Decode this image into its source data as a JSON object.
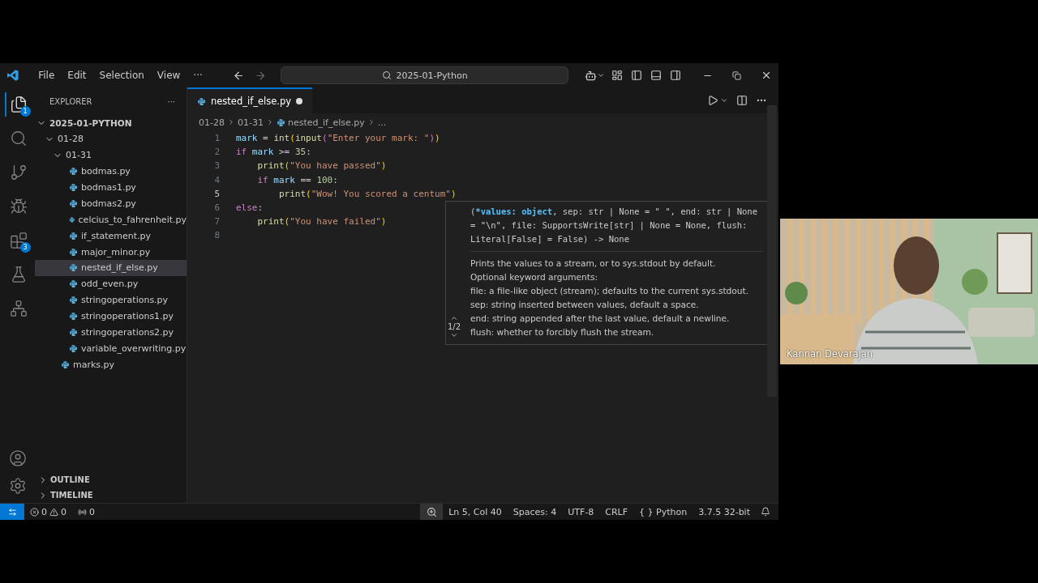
{
  "titlebar": {
    "menus": [
      "File",
      "Edit",
      "Selection",
      "View"
    ],
    "more": "···",
    "search": "2025-01-Python"
  },
  "activity_bar": [
    {
      "kind": "files",
      "badge": "1",
      "selected": true
    },
    {
      "kind": "search",
      "selected": false
    },
    {
      "kind": "git",
      "selected": false
    },
    {
      "kind": "debug",
      "selected": false
    },
    {
      "kind": "extensions",
      "badge": "3",
      "selected": false
    },
    {
      "kind": "flask",
      "selected": false
    },
    {
      "kind": "tree",
      "selected": false
    }
  ],
  "explorer": {
    "title": "EXPLORER",
    "more": "···",
    "tree": [
      {
        "label": "2025-01-PYTHON",
        "kind": "folder",
        "expanded": true,
        "children": [
          {
            "label": "01-28",
            "kind": "folder",
            "expanded": true,
            "children": [
              {
                "label": "01-31",
                "kind": "folder",
                "expanded": true,
                "children": [
                  {
                    "label": "bodmas.py",
                    "kind": "file",
                    "selected": false
                  },
                  {
                    "label": "bodmas1.py",
                    "kind": "file",
                    "selected": false
                  },
                  {
                    "label": "bodmas2.py",
                    "kind": "file",
                    "selected": false
                  },
                  {
                    "label": "celcius_to_fahrenheit.py",
                    "kind": "file",
                    "selected": false
                  },
                  {
                    "label": "if_statement.py",
                    "kind": "file",
                    "selected": false
                  },
                  {
                    "label": "major_minor.py",
                    "kind": "file",
                    "selected": false
                  },
                  {
                    "label": "nested_if_else.py",
                    "kind": "file",
                    "selected": true
                  },
                  {
                    "label": "odd_even.py",
                    "kind": "file",
                    "selected": false
                  },
                  {
                    "label": "stringoperations.py",
                    "kind": "file",
                    "selected": false
                  },
                  {
                    "label": "stringoperations1.py",
                    "kind": "file",
                    "selected": false
                  },
                  {
                    "label": "stringoperations2.py",
                    "kind": "file",
                    "selected": false
                  },
                  {
                    "label": "variable_overwriting.py",
                    "kind": "file",
                    "selected": false
                  }
                ]
              },
              {
                "label": "marks.py",
                "kind": "file",
                "selected": false
              }
            ]
          }
        ]
      }
    ]
  },
  "sections": [
    {
      "label": "OUTLINE",
      "expanded": false
    },
    {
      "label": "TIMELINE",
      "expanded": false
    }
  ],
  "tabs": [
    {
      "label": "nested_if_else.py",
      "modified": true,
      "selected": true
    }
  ],
  "breadcrumb": [
    "01-28",
    "01-31",
    "nested_if_else.py",
    "..."
  ],
  "code": [
    {
      "number": "1",
      "active": false,
      "tokens": [
        {
          "kind": "var",
          "text": "mark"
        },
        {
          "kind": "plain",
          "text": " = "
        },
        {
          "kind": "fn",
          "text": "int"
        },
        {
          "kind": "paren",
          "text": "("
        },
        {
          "kind": "fn",
          "text": "input"
        },
        {
          "kind": "paren2",
          "text": "("
        },
        {
          "kind": "str",
          "text": "\"Enter your mark: \""
        },
        {
          "kind": "paren2",
          "text": ")"
        },
        {
          "kind": "paren",
          "text": ")"
        }
      ]
    },
    {
      "number": "2",
      "active": false,
      "tokens": [
        {
          "kind": "kw",
          "text": "if"
        },
        {
          "kind": "var",
          "text": " mark"
        },
        {
          "kind": "plain",
          "text": " >= "
        },
        {
          "kind": "num",
          "text": "35"
        },
        {
          "kind": "plain",
          "text": ":"
        }
      ]
    },
    {
      "number": "3",
      "active": false,
      "tokens": [
        {
          "kind": "fn",
          "text": "    print"
        },
        {
          "kind": "paren",
          "text": "("
        },
        {
          "kind": "str",
          "text": "\"You have passed\""
        },
        {
          "kind": "paren",
          "text": ")"
        }
      ]
    },
    {
      "number": "4",
      "active": false,
      "tokens": [
        {
          "kind": "kw",
          "text": "    if"
        },
        {
          "kind": "var",
          "text": " mark"
        },
        {
          "kind": "plain",
          "text": " == "
        },
        {
          "kind": "num",
          "text": "100"
        },
        {
          "kind": "plain",
          "text": ":"
        }
      ]
    },
    {
      "number": "5",
      "active": true,
      "tokens": [
        {
          "kind": "fn",
          "text": "        print"
        },
        {
          "kind": "paren",
          "text": "("
        },
        {
          "kind": "str",
          "text": "\"Wow! You scored a centum\""
        },
        {
          "kind": "paren",
          "text": ")"
        }
      ]
    },
    {
      "number": "6",
      "active": false,
      "tokens": [
        {
          "kind": "kw",
          "text": "else"
        },
        {
          "kind": "plain",
          "text": ":"
        }
      ]
    },
    {
      "number": "7",
      "active": false,
      "tokens": [
        {
          "kind": "fn",
          "text": "    print"
        },
        {
          "kind": "paren",
          "text": "("
        },
        {
          "kind": "str",
          "text": "\"You have failed\""
        },
        {
          "kind": "paren",
          "text": ")"
        }
      ]
    },
    {
      "number": "8",
      "active": false
    }
  ],
  "hover": {
    "signature": [
      {
        "kind": "plain",
        "text": "("
      },
      {
        "kind": "active",
        "text": "*values: object"
      },
      {
        "kind": "plain",
        "text": ", sep: str | None = \" \", end: str | None = \"\\n\", file: SupportsWrite[str] | None = None, flush: Literal[False] = False) -> None"
      }
    ],
    "doc": [
      "Prints the values to a stream, or to sys.stdout by default.",
      "Optional keyword arguments:",
      "file: a file-like object (stream); defaults to the current sys.stdout.",
      "sep: string inserted between values, default a space.",
      "end: string appended after the last value, default a newline.",
      "flush: whether to forcibly flush the stream."
    ],
    "counter": "1/2"
  },
  "status_bar": {
    "errors": "0",
    "warnings": "0",
    "ports": "0",
    "items": [
      "Ln 5, Col 40",
      "Spaces: 4",
      "UTF-8",
      "CRLF",
      "{ } Python",
      "3.7.5 32-bit"
    ]
  },
  "video": {
    "kind": "picture",
    "name": "Kannan Devarajan"
  }
}
